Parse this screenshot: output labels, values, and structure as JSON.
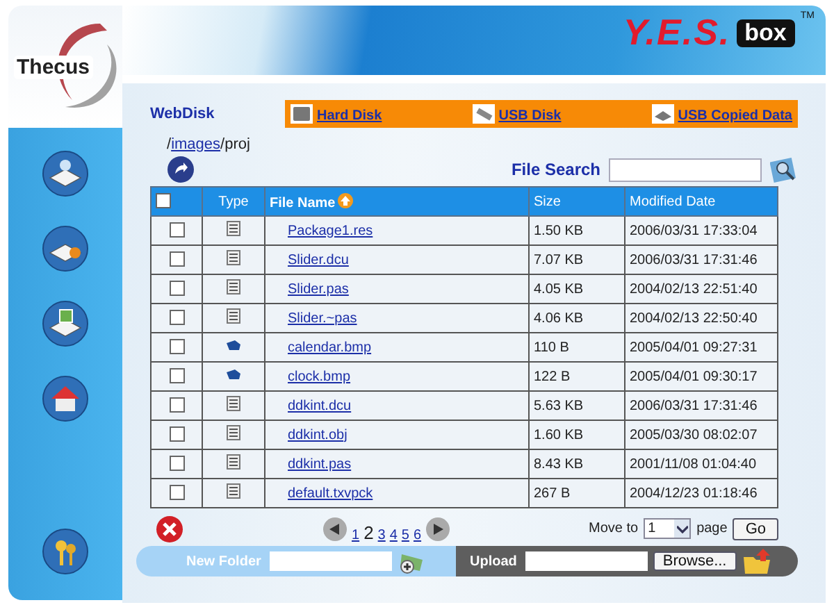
{
  "brand": {
    "company": "Thecus",
    "product_main": "Y.E.S.",
    "product_box": "box",
    "trademark": "TM"
  },
  "sidebar": {
    "items": [
      {
        "kind": "disk"
      },
      {
        "kind": "backup"
      },
      {
        "kind": "photo"
      },
      {
        "kind": "home"
      },
      {
        "kind": "keys"
      }
    ]
  },
  "section_title": "WebDisk",
  "tabs": [
    {
      "label": "Hard Disk",
      "kind": "hdd"
    },
    {
      "label": "USB Disk",
      "kind": "usb"
    },
    {
      "label": "USB Copied Data",
      "kind": "copied"
    }
  ],
  "breadcrumb": {
    "prefix": "/",
    "link": "images",
    "suffix": "/proj"
  },
  "search": {
    "label": "File Search"
  },
  "table": {
    "columns": [
      "Type",
      "File Name",
      "Size",
      "Modified Date"
    ],
    "select_all": {
      "checked": false
    },
    "rows": [
      {
        "checked": false,
        "kind": "text",
        "name": "Package1.res",
        "size": "1.50 KB",
        "modified": "2006/03/31 17:33:04"
      },
      {
        "checked": false,
        "kind": "text",
        "name": "Slider.dcu",
        "size": "7.07 KB",
        "modified": "2006/03/31 17:31:46"
      },
      {
        "checked": false,
        "kind": "text",
        "name": "Slider.pas",
        "size": "4.05 KB",
        "modified": "2004/02/13 22:51:40"
      },
      {
        "checked": false,
        "kind": "text",
        "name": "Slider.~pas",
        "size": "4.06 KB",
        "modified": "2004/02/13 22:50:40"
      },
      {
        "checked": false,
        "kind": "image",
        "name": "calendar.bmp",
        "size": "110 B",
        "modified": "2005/04/01 09:27:31"
      },
      {
        "checked": false,
        "kind": "image",
        "name": "clock.bmp",
        "size": "122 B",
        "modified": "2005/04/01 09:30:17"
      },
      {
        "checked": false,
        "kind": "text",
        "name": "ddkint.dcu",
        "size": "5.63 KB",
        "modified": "2006/03/31 17:31:46"
      },
      {
        "checked": false,
        "kind": "text",
        "name": "ddkint.obj",
        "size": "1.60 KB",
        "modified": "2005/03/30 08:02:07"
      },
      {
        "checked": false,
        "kind": "text",
        "name": "ddkint.pas",
        "size": "8.43 KB",
        "modified": "2001/11/08 01:04:40"
      },
      {
        "checked": false,
        "kind": "text",
        "name": "default.txvpck",
        "size": "267 B",
        "modified": "2004/12/23 01:18:46"
      }
    ]
  },
  "pagination": {
    "pages": [
      {
        "label": "1",
        "selected": false
      },
      {
        "label": "2",
        "selected": true
      },
      {
        "label": "3",
        "selected": false
      },
      {
        "label": "4",
        "selected": false
      },
      {
        "label": "5",
        "selected": false
      },
      {
        "label": "6",
        "selected": false
      }
    ],
    "move_to_label": "Move to",
    "page_value": "1",
    "page_label": "page",
    "go": "Go"
  },
  "new_folder": {
    "label": "New Folder"
  },
  "upload": {
    "label": "Upload",
    "browse": "Browse..."
  }
}
